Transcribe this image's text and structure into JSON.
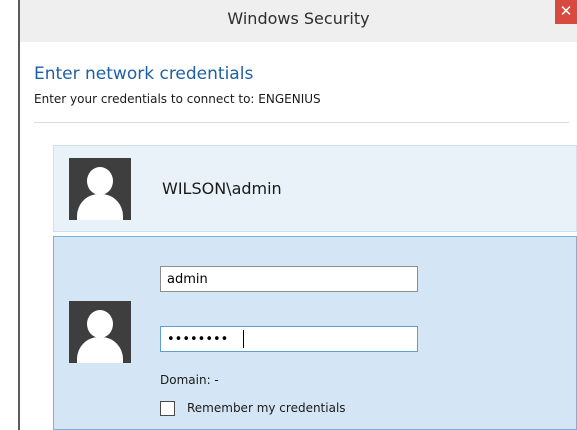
{
  "window": {
    "title": "Windows Security",
    "close_glyph": "✕"
  },
  "dialog": {
    "heading": "Enter network credentials",
    "subheading": "Enter your credentials to connect to: ENGENIUS"
  },
  "accounts": [
    {
      "name": "WILSON\\admin",
      "avatar_icon": "user-avatar-icon"
    }
  ],
  "login": {
    "avatar_icon": "user-avatar-icon",
    "username_value": "admin",
    "password_value": "••••••••",
    "domain_text": "Domain: -",
    "remember_label": "Remember my credentials",
    "remember_checked": false
  },
  "colors": {
    "heading": "#1e5fa5",
    "close_button": "#d84a40",
    "selected_tile": "#d4e6f5",
    "tile": "#e9f2f9"
  }
}
